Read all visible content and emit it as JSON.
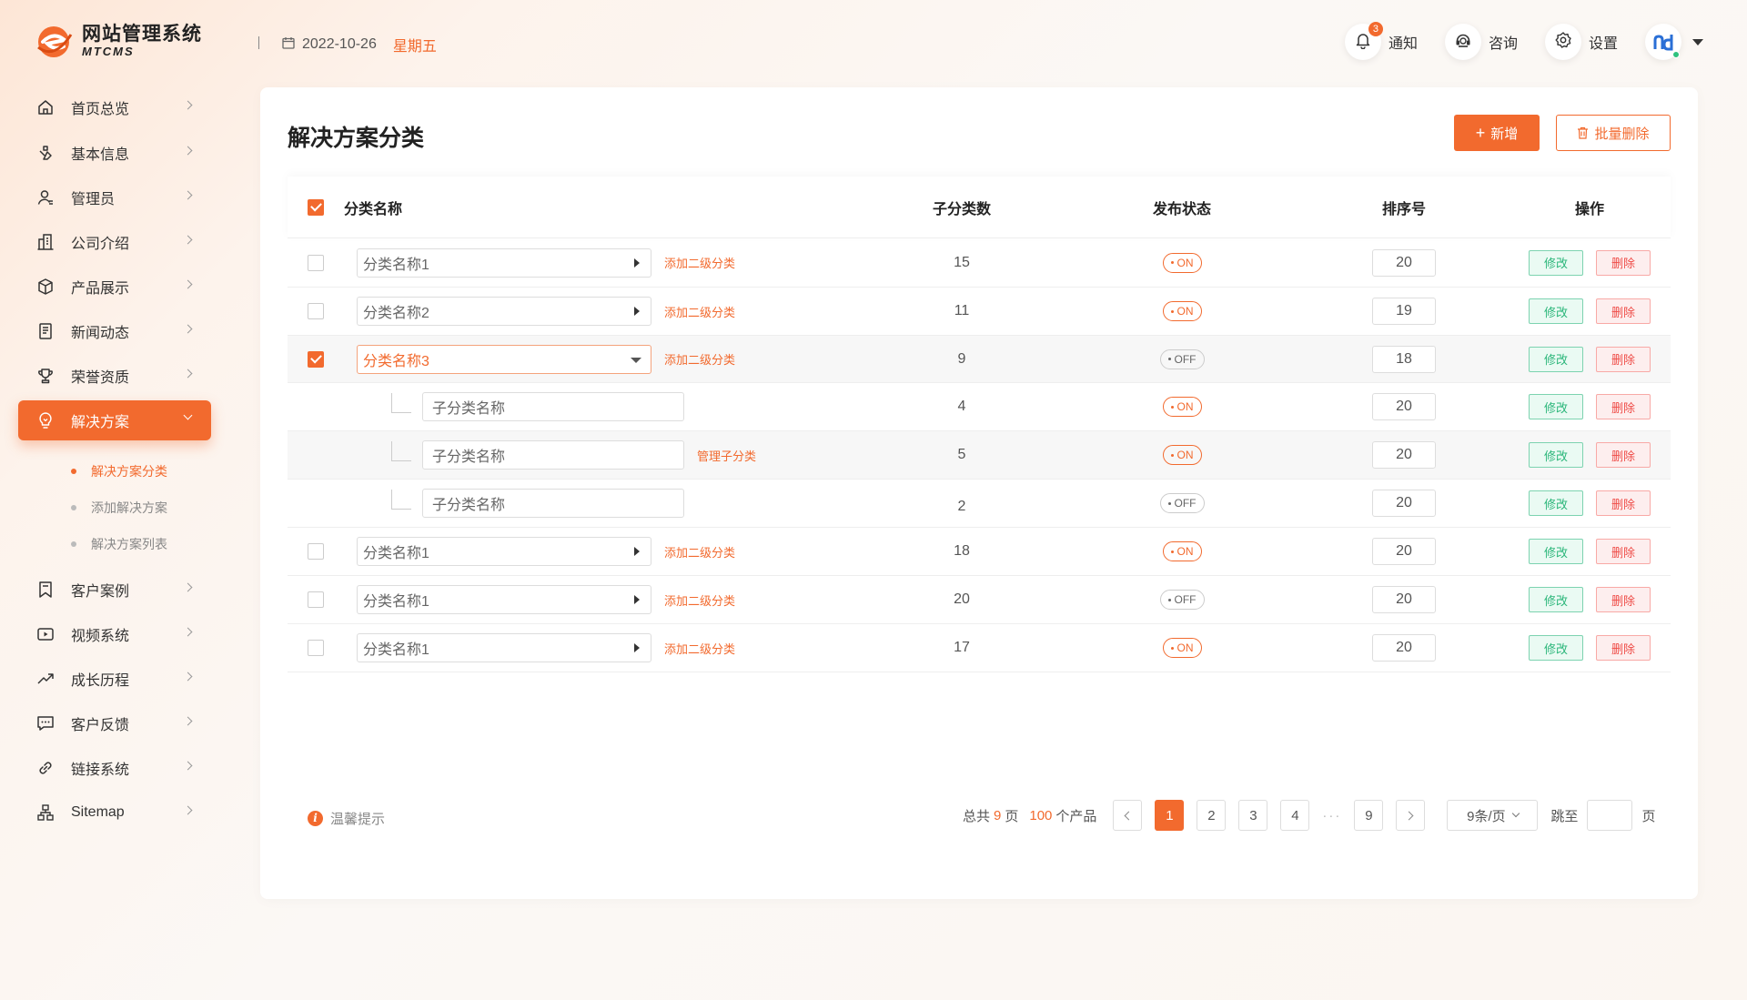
{
  "brand": {
    "title": "网站管理系统",
    "subtitle": "MTCMS"
  },
  "header": {
    "date": "2022-10-26",
    "weekday": "星期五",
    "notify": {
      "label": "通知",
      "count": "3"
    },
    "consult": {
      "label": "咨询"
    },
    "settings": {
      "label": "设置"
    },
    "colors": {
      "accent": "#f26a2e"
    }
  },
  "sidebar": {
    "items": [
      {
        "label": "首页总览",
        "icon": "home-icon"
      },
      {
        "label": "基本信息",
        "icon": "info-icon"
      },
      {
        "label": "管理员",
        "icon": "user-icon"
      },
      {
        "label": "公司介绍",
        "icon": "building-icon"
      },
      {
        "label": "产品展示",
        "icon": "box-icon"
      },
      {
        "label": "新闻动态",
        "icon": "news-icon"
      },
      {
        "label": "荣誉资质",
        "icon": "trophy-icon"
      },
      {
        "label": "解决方案",
        "icon": "bulb-icon",
        "active": true
      },
      {
        "label": "客户案例",
        "icon": "bookmark-icon"
      },
      {
        "label": "视频系统",
        "icon": "video-icon"
      },
      {
        "label": "成长历程",
        "icon": "trend-icon"
      },
      {
        "label": "客户反馈",
        "icon": "feedback-icon"
      },
      {
        "label": "链接系统",
        "icon": "link-icon"
      },
      {
        "label": "Sitemap",
        "icon": "sitemap-icon"
      }
    ],
    "sub_items": [
      {
        "label": "解决方案分类",
        "active": true
      },
      {
        "label": "添加解决方案"
      },
      {
        "label": "解决方案列表"
      }
    ]
  },
  "main": {
    "title": "解决方案分类",
    "add_label": "新增",
    "bulk_delete_label": "批量删除",
    "columns": [
      "分类名称",
      "子分类数",
      "发布状态",
      "排序号",
      "操作"
    ],
    "edit_label": "修改",
    "delete_label": "删除",
    "rows": [
      {
        "name": "分类名称1",
        "type": "parent",
        "link": "添加二级分类",
        "count": "15",
        "status": "ON",
        "sort": "20",
        "checked": false
      },
      {
        "name": "分类名称2",
        "type": "parent",
        "link": "添加二级分类",
        "count": "11",
        "status": "ON",
        "sort": "19",
        "checked": false
      },
      {
        "name": "分类名称3",
        "type": "parent-open",
        "link": "添加二级分类",
        "count": "9",
        "status": "OFF",
        "sort": "18",
        "checked": true
      },
      {
        "name": "子分类名称",
        "type": "child",
        "link": "",
        "count": "4",
        "status": "ON",
        "sort": "20"
      },
      {
        "name": "子分类名称",
        "type": "child",
        "link": "管理子分类",
        "count": "5",
        "status": "ON",
        "sort": "20"
      },
      {
        "name": "子分类名称",
        "type": "child",
        "link": "",
        "count": "2",
        "status": "OFF",
        "sort": "20"
      },
      {
        "name": "分类名称1",
        "type": "parent",
        "link": "添加二级分类",
        "count": "18",
        "status": "ON",
        "sort": "20",
        "checked": false
      },
      {
        "name": "分类名称1",
        "type": "parent",
        "link": "添加二级分类",
        "count": "20",
        "status": "OFF",
        "sort": "20",
        "checked": false
      },
      {
        "name": "分类名称1",
        "type": "parent",
        "link": "添加二级分类",
        "count": "17",
        "status": "ON",
        "sort": "20",
        "checked": false
      }
    ]
  },
  "footer": {
    "tip": "温馨提示",
    "total_prefix": "总共",
    "total_pages": "9",
    "pages_unit": "页",
    "total_items": "100",
    "items_unit": "个产品",
    "pages": [
      "1",
      "2",
      "3",
      "4"
    ],
    "ellipsis": "···",
    "last_page": "9",
    "current_page": "1",
    "page_size": "9条/页",
    "jump_label": "跳至",
    "jump_unit": "页"
  }
}
